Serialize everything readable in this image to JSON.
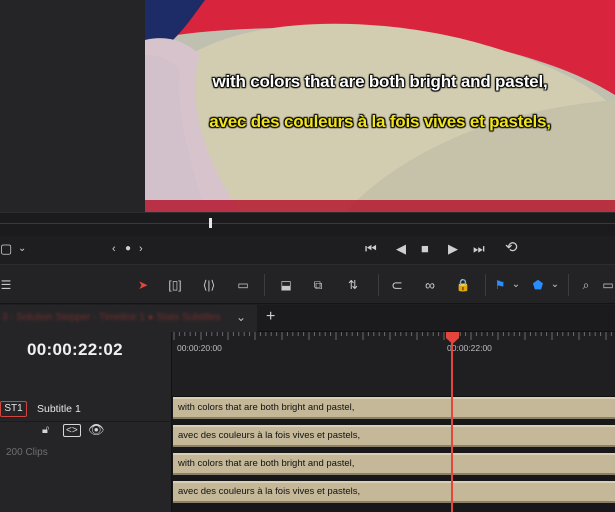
{
  "viewer": {
    "subtitle_line_1": "with colors that are both bright and pastel,",
    "subtitle_line_2": "avec des couleurs à la fois vives et pastels,"
  },
  "timeline": {
    "tab_title": "3 - Solution Stepper - Timeline 1 ● Stats Subtitles",
    "add_tab": "+",
    "timecode": "00:00:22:02",
    "ruler_labels": [
      "00:00:20:00",
      "00:00:22:00"
    ]
  },
  "track": {
    "badge": "ST1",
    "name": "Subtitle 1",
    "clip_count": "200 Clips"
  },
  "clips": [
    "with colors that are both bright and pastel,",
    "avec des couleurs à la fois vives et pastels,",
    "with colors that are both bright and pastel,",
    "avec des couleurs à la fois vives et pastels,"
  ],
  "colors": {
    "accent_red": "#e6453b",
    "clip": "#c4b898",
    "subtitle_fr": "#f2e51c",
    "flag_blue": "#1e90ff"
  }
}
